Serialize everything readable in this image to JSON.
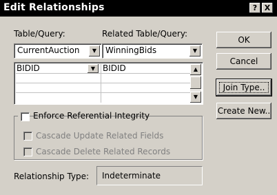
{
  "window": {
    "title": "Edit Relationships",
    "help_button": "?",
    "close_button": "X"
  },
  "table_query": {
    "label": "Table/Query:",
    "value": "CurrentAuction"
  },
  "related_table_query": {
    "label": "Related Table/Query:",
    "value": "WinningBids"
  },
  "fields_grid": {
    "rows": [
      {
        "left": "BIDID",
        "right": "BIDID"
      },
      {
        "left": "",
        "right": ""
      },
      {
        "left": "",
        "right": ""
      },
      {
        "left": "",
        "right": ""
      }
    ]
  },
  "buttons": {
    "ok": "OK",
    "cancel": "Cancel",
    "join_type": "Join Type..",
    "create_new": "Create New.."
  },
  "options": {
    "enforce_referential_integrity": {
      "label": "Enforce Referential Integrity",
      "checked": false,
      "enabled": true
    },
    "cascade_update": {
      "label": "Cascade Update Related Fields",
      "checked": false,
      "enabled": false
    },
    "cascade_delete": {
      "label": "Cascade Delete Related Records",
      "checked": false,
      "enabled": false
    }
  },
  "relationship_type": {
    "label": "Relationship Type:",
    "value": "Indeterminate"
  }
}
